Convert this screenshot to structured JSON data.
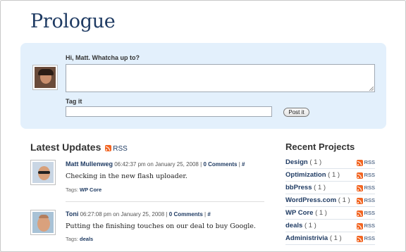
{
  "site": {
    "title": "Prologue"
  },
  "postbox": {
    "question": "Hi, Matt. Whatcha up to?",
    "textarea_value": "",
    "tag_label": "Tag it",
    "tag_value": "",
    "submit_label": "Post it"
  },
  "latest": {
    "title": "Latest Updates",
    "rss_label": "RSS",
    "updates": [
      {
        "author": "Matt Mullenweg",
        "time": "06:42:37 pm on January 25, 2008",
        "sep": "|",
        "comments": "0 Comments",
        "permalink": "#",
        "text": "Checking in the new flash uploader.",
        "tags_label": "Tags:",
        "tags": "WP Core"
      },
      {
        "author": "Toni",
        "time": "06:27:08 pm on January 25, 2008",
        "sep": "|",
        "comments": "0 Comments",
        "permalink": "#",
        "text": "Putting the finishing touches on our deal to buy Google.",
        "tags_label": "Tags:",
        "tags": "deals"
      }
    ]
  },
  "projects": {
    "title": "Recent Projects",
    "rss_label": "RSS",
    "items": [
      {
        "name": "Design",
        "count": "( 1 )"
      },
      {
        "name": "Optimization",
        "count": "( 1 )"
      },
      {
        "name": "bbPress",
        "count": "( 1 )"
      },
      {
        "name": "WordPress.com",
        "count": "( 1 )"
      },
      {
        "name": "WP Core",
        "count": "( 1 )"
      },
      {
        "name": "deals",
        "count": "( 1 )"
      },
      {
        "name": "Administrivia",
        "count": "( 1 )"
      }
    ]
  },
  "colors": {
    "title": "#1f3b63",
    "postbox_bg": "#e3f0fc",
    "rss": "#f26522"
  }
}
